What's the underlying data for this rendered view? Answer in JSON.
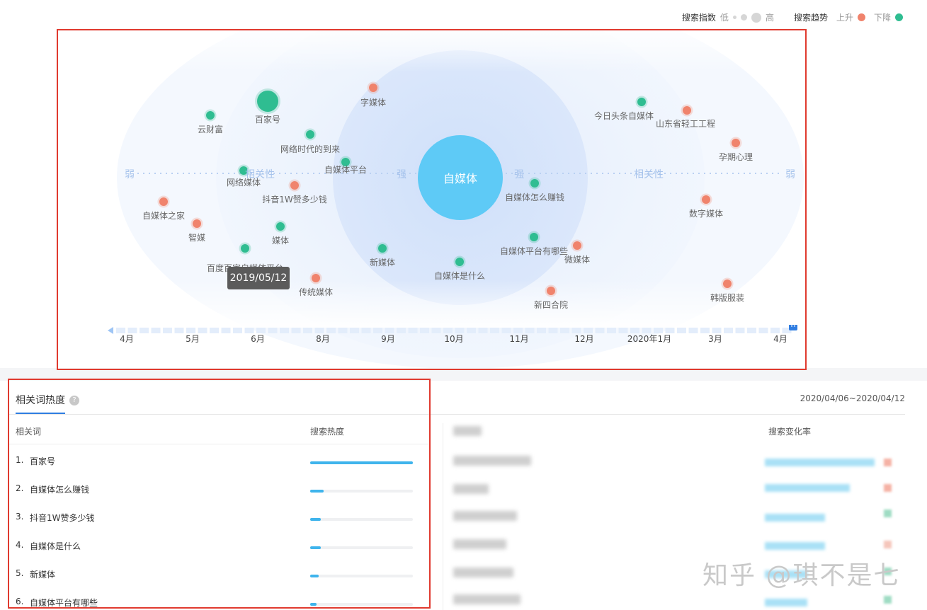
{
  "legend": {
    "index_label": "搜索指数",
    "low": "低",
    "high": "高",
    "trend_label": "搜索趋势",
    "up": "上升",
    "down": "下降",
    "up_color": "#f0836c",
    "down_color": "#2fbd91"
  },
  "radar": {
    "center_word": "自媒体",
    "axis": {
      "weak": "弱",
      "strong": "强",
      "relevance": "相关性"
    },
    "tooltip": "2019/05/12",
    "nodes": [
      {
        "word": "百家号",
        "trend": "down",
        "level": 3
      },
      {
        "word": "字媒体",
        "trend": "up",
        "level": 1
      },
      {
        "word": "云财富",
        "trend": "down",
        "level": 1
      },
      {
        "word": "网络时代的到来",
        "trend": "down",
        "level": 1
      },
      {
        "word": "自媒体平台",
        "trend": "down",
        "level": 1
      },
      {
        "word": "网络媒体",
        "trend": "down",
        "level": 1
      },
      {
        "word": "抖音1W赞多少钱",
        "trend": "up",
        "level": 1
      },
      {
        "word": "自媒体之家",
        "trend": "up",
        "level": 1
      },
      {
        "word": "智媒",
        "trend": "up",
        "level": 1
      },
      {
        "word": "媒体",
        "trend": "down",
        "level": 1
      },
      {
        "word": "百度百家自媒体平台",
        "trend": "down",
        "level": 1
      },
      {
        "word": "传统媒体",
        "trend": "up",
        "level": 1
      },
      {
        "word": "新媒体",
        "trend": "down",
        "level": 1
      },
      {
        "word": "自媒体是什么",
        "trend": "down",
        "level": 1
      },
      {
        "word": "自媒体怎么赚钱",
        "trend": "down",
        "level": 1
      },
      {
        "word": "自媒体平台有哪些",
        "trend": "down",
        "level": 1
      },
      {
        "word": "微媒体",
        "trend": "up",
        "level": 1
      },
      {
        "word": "新四合院",
        "trend": "up",
        "level": 1
      },
      {
        "word": "今日头条自媒体",
        "trend": "down",
        "level": 1
      },
      {
        "word": "山东省轻工工程",
        "trend": "up",
        "level": 1
      },
      {
        "word": "孕期心理",
        "trend": "up",
        "level": 1
      },
      {
        "word": "数字媒体",
        "trend": "up",
        "level": 1
      },
      {
        "word": "韩版服装",
        "trend": "up",
        "level": 1
      }
    ],
    "timeline": [
      "4月",
      "5月",
      "6月",
      "8月",
      "9月",
      "10月",
      "11月",
      "12月",
      "2020年1月",
      "3月",
      "4月"
    ]
  },
  "related": {
    "tab": "相关词热度",
    "help_icon": "question-icon",
    "date_range": "2020/04/06~2020/04/12",
    "col_word": "相关词",
    "col_heat": "搜索热度",
    "col_change": "搜索变化率",
    "rows": [
      {
        "rank": "1.",
        "word": "百家号",
        "heat": 1.0
      },
      {
        "rank": "2.",
        "word": "自媒体怎么赚钱",
        "heat": 0.13
      },
      {
        "rank": "3.",
        "word": "抖音1W赞多少钱",
        "heat": 0.1
      },
      {
        "rank": "4.",
        "word": "自媒体是什么",
        "heat": 0.1
      },
      {
        "rank": "5.",
        "word": "新媒体",
        "heat": 0.08
      },
      {
        "rank": "6.",
        "word": "自媒体平台有哪些",
        "heat": 0.06
      }
    ]
  },
  "watermark": "知乎 @琪不是七"
}
